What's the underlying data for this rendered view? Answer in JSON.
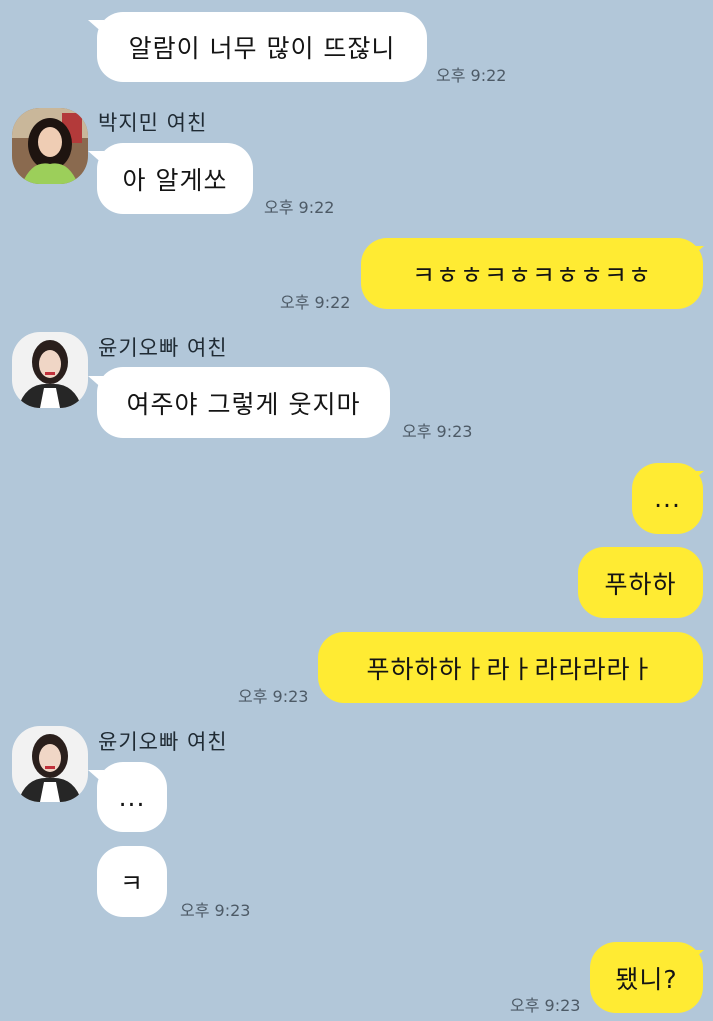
{
  "chat": {
    "messages": [
      {
        "text": "알람이 너무 많이 뜨잖니",
        "time": "오후 9:22"
      },
      {
        "sender": "박지민 여친",
        "text": "아 알게쏘",
        "time": "오후 9:22"
      },
      {
        "text": "ㅋㅎㅎㅋㅎㅋㅎㅎㅋㅎ",
        "time": "오후 9:22"
      },
      {
        "sender": "윤기오빠 여친",
        "text": "여주야 그렇게 웃지마",
        "time": "오후 9:23"
      },
      {
        "text": "..."
      },
      {
        "text": "푸하하"
      },
      {
        "text": "푸하하하ㅏ라ㅏ라라라라ㅏ",
        "time": "오후 9:23"
      },
      {
        "sender": "윤기오빠 여친",
        "text": "..."
      },
      {
        "text": "ㅋ",
        "time": "오후 9:23"
      },
      {
        "text": "됐니?",
        "time": "오후 9:23"
      }
    ]
  },
  "colors": {
    "background": "#b2c7d9",
    "incoming_bubble": "#ffffff",
    "outgoing_bubble": "#ffeb33"
  }
}
